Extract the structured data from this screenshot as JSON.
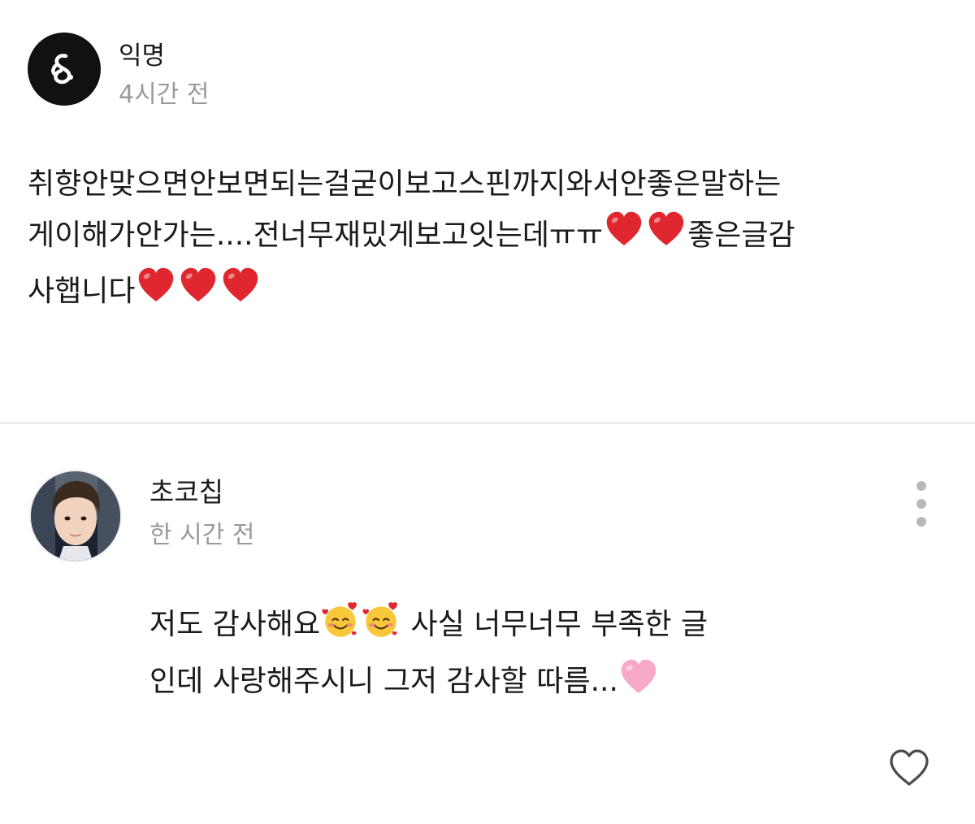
{
  "top_comment": {
    "author": "익명",
    "timestamp": "4시간 전",
    "avatar_icon": "anonymous-logo-icon",
    "body_segments": [
      {
        "type": "text",
        "value": "취향안맞으면안보면되는걸굳이보고스핀까지와서안좋은말하는\n게이해가안가는....전너무재밌게보고잇는데ㅠㅠ"
      },
      {
        "type": "emoji",
        "value": "red-heart-icon"
      },
      {
        "type": "emoji",
        "value": "red-heart-icon"
      },
      {
        "type": "text",
        "value": "좋은글감\n사햅니다"
      },
      {
        "type": "emoji",
        "value": "red-heart-icon"
      },
      {
        "type": "emoji",
        "value": "red-heart-icon"
      },
      {
        "type": "emoji",
        "value": "red-heart-icon"
      }
    ]
  },
  "reply": {
    "author": "초코칩",
    "timestamp": "한 시간 전",
    "avatar_icon": "profile-photo-avatar",
    "more_icon": "more-vertical-icon",
    "like_icon": "heart-outline-icon",
    "body_segments": [
      {
        "type": "text",
        "value": "저도 감사해요"
      },
      {
        "type": "emoji",
        "value": "smiling-face-with-hearts-icon"
      },
      {
        "type": "emoji",
        "value": "smiling-face-with-hearts-icon"
      },
      {
        "type": "text",
        "value": " 사실 너무너무 부족한 글\n인데 사랑해주시니 그저 감사할 따름..."
      },
      {
        "type": "emoji",
        "value": "pink-heart-icon"
      }
    ]
  },
  "colors": {
    "text": "#1a1a1a",
    "muted": "#9a9a9a",
    "divider": "#ececec",
    "red_heart": "#e0262f",
    "pink_heart": "#f7a9c8",
    "more_dots": "#b8b8b8"
  }
}
